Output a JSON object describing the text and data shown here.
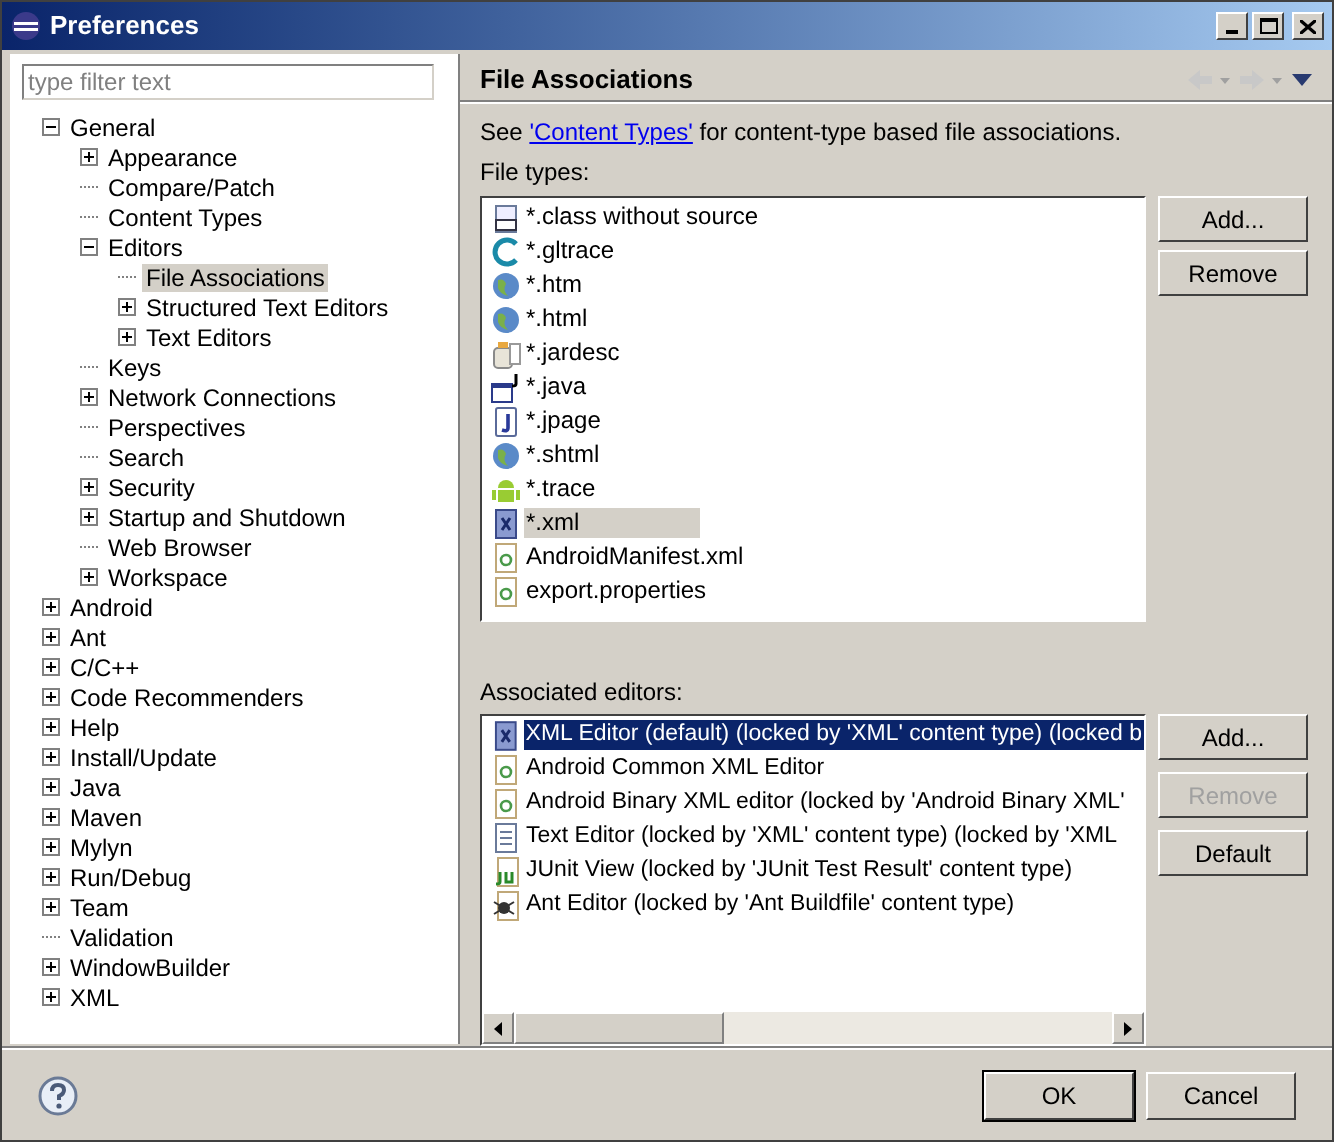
{
  "window": {
    "title": "Preferences"
  },
  "filter": {
    "placeholder": "type filter text"
  },
  "tree": [
    {
      "label": "General",
      "expanded": true,
      "selected": false,
      "children": [
        {
          "label": "Appearance",
          "expanded": false,
          "selected": false
        },
        {
          "label": "Compare/Patch",
          "selected": false
        },
        {
          "label": "Content Types",
          "selected": false
        },
        {
          "label": "Editors",
          "expanded": true,
          "selected": false,
          "children": [
            {
              "label": "File Associations",
              "selected": true
            },
            {
              "label": "Structured Text Editors",
              "expanded": false,
              "selected": false
            },
            {
              "label": "Text Editors",
              "expanded": false,
              "selected": false
            }
          ]
        },
        {
          "label": "Keys",
          "selected": false
        },
        {
          "label": "Network Connections",
          "expanded": false,
          "selected": false
        },
        {
          "label": "Perspectives",
          "selected": false
        },
        {
          "label": "Search",
          "selected": false
        },
        {
          "label": "Security",
          "expanded": false,
          "selected": false
        },
        {
          "label": "Startup and Shutdown",
          "expanded": false,
          "selected": false
        },
        {
          "label": "Web Browser",
          "selected": false
        },
        {
          "label": "Workspace",
          "expanded": false,
          "selected": false
        }
      ]
    },
    {
      "label": "Android",
      "expanded": false,
      "selected": false
    },
    {
      "label": "Ant",
      "expanded": false,
      "selected": false
    },
    {
      "label": "C/C++",
      "expanded": false,
      "selected": false
    },
    {
      "label": "Code Recommenders",
      "expanded": false,
      "selected": false
    },
    {
      "label": "Help",
      "expanded": false,
      "selected": false
    },
    {
      "label": "Install/Update",
      "expanded": false,
      "selected": false
    },
    {
      "label": "Java",
      "expanded": false,
      "selected": false
    },
    {
      "label": "Maven",
      "expanded": false,
      "selected": false
    },
    {
      "label": "Mylyn",
      "expanded": false,
      "selected": false
    },
    {
      "label": "Run/Debug",
      "expanded": false,
      "selected": false
    },
    {
      "label": "Team",
      "expanded": false,
      "selected": false
    },
    {
      "label": "Validation",
      "selected": false
    },
    {
      "label": "WindowBuilder",
      "expanded": false,
      "selected": false
    },
    {
      "label": "XML",
      "expanded": false,
      "selected": false
    }
  ],
  "page": {
    "title": "File Associations",
    "intro_before": "See ",
    "intro_link": "'Content Types'",
    "intro_after": " for content-type based file associations.",
    "file_types_label": "File types:",
    "file_types": [
      {
        "label": "*.class without source",
        "selected": false
      },
      {
        "label": "*.gltrace",
        "selected": false
      },
      {
        "label": "*.htm",
        "selected": false
      },
      {
        "label": "*.html",
        "selected": false
      },
      {
        "label": "*.jardesc",
        "selected": false
      },
      {
        "label": "*.java",
        "selected": false
      },
      {
        "label": "*.jpage",
        "selected": false
      },
      {
        "label": "*.shtml",
        "selected": false
      },
      {
        "label": "*.trace",
        "selected": false
      },
      {
        "label": "*.xml",
        "selected": true
      },
      {
        "label": "AndroidManifest.xml",
        "selected": false
      },
      {
        "label": "export.properties",
        "selected": false
      }
    ],
    "file_type_buttons": [
      {
        "label": "Add...",
        "disabled": false
      },
      {
        "label": "Remove",
        "disabled": false
      }
    ],
    "editors_label": "Associated editors:",
    "editors": [
      {
        "label": "XML Editor (default) (locked by 'XML' content type) (locked b",
        "selected": true
      },
      {
        "label": "Android Common XML Editor",
        "selected": false
      },
      {
        "label": "Android Binary XML editor (locked by 'Android Binary XML'",
        "selected": false
      },
      {
        "label": "Text Editor (locked by 'XML' content type) (locked by 'XML",
        "selected": false
      },
      {
        "label": "JUnit View (locked by 'JUnit Test Result' content type)",
        "selected": false
      },
      {
        "label": "Ant Editor (locked by 'Ant Buildfile' content type)",
        "selected": false
      }
    ],
    "editor_buttons": [
      {
        "label": "Add...",
        "disabled": false
      },
      {
        "label": "Remove",
        "disabled": true
      },
      {
        "label": "Default",
        "disabled": false
      }
    ]
  },
  "dialog_buttons": [
    {
      "label": "OK",
      "default": true
    },
    {
      "label": "Cancel",
      "default": false
    }
  ]
}
